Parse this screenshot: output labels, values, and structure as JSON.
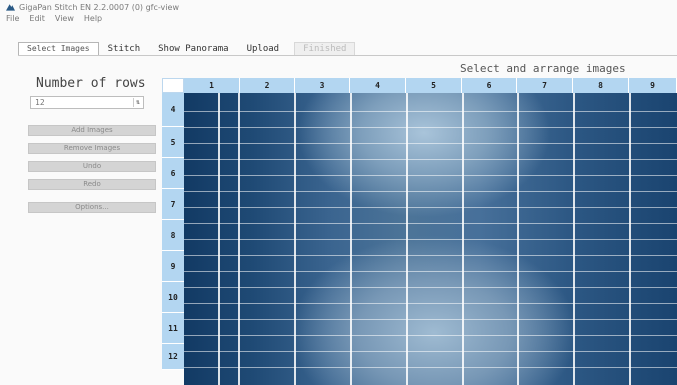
{
  "window": {
    "title": "GigaPan Stitch EN 2.2.0007 (0) gfc-view"
  },
  "menu": {
    "items": [
      "File",
      "Edit",
      "View",
      "Help"
    ]
  },
  "tabs": [
    {
      "label": "Select Images",
      "state": "active"
    },
    {
      "label": "Stitch",
      "state": "normal"
    },
    {
      "label": "Show Panorama",
      "state": "normal"
    },
    {
      "label": "Upload",
      "state": "normal"
    },
    {
      "label": "Finished",
      "state": "disabled"
    }
  ],
  "left_panel": {
    "rows_label": "Number of rows",
    "rows_value": "12",
    "buttons": [
      "Add Images",
      "Remove Images",
      "Undo",
      "Redo",
      "Options..."
    ]
  },
  "header": {
    "instruction": "Select and arrange images"
  },
  "grid": {
    "columns": [
      "1",
      "2",
      "3",
      "4",
      "5",
      "6",
      "7",
      "8",
      "9"
    ],
    "rows": [
      "4",
      "5",
      "6",
      "7",
      "8",
      "9",
      "10",
      "11",
      "12"
    ]
  },
  "colors": {
    "header_blue": "#b3d6f1",
    "image_dark": "#123a64",
    "image_light": "#a9c4da"
  },
  "icons": {
    "app": "gigapan-app-icon",
    "spinner": "spin-updown-icon"
  }
}
